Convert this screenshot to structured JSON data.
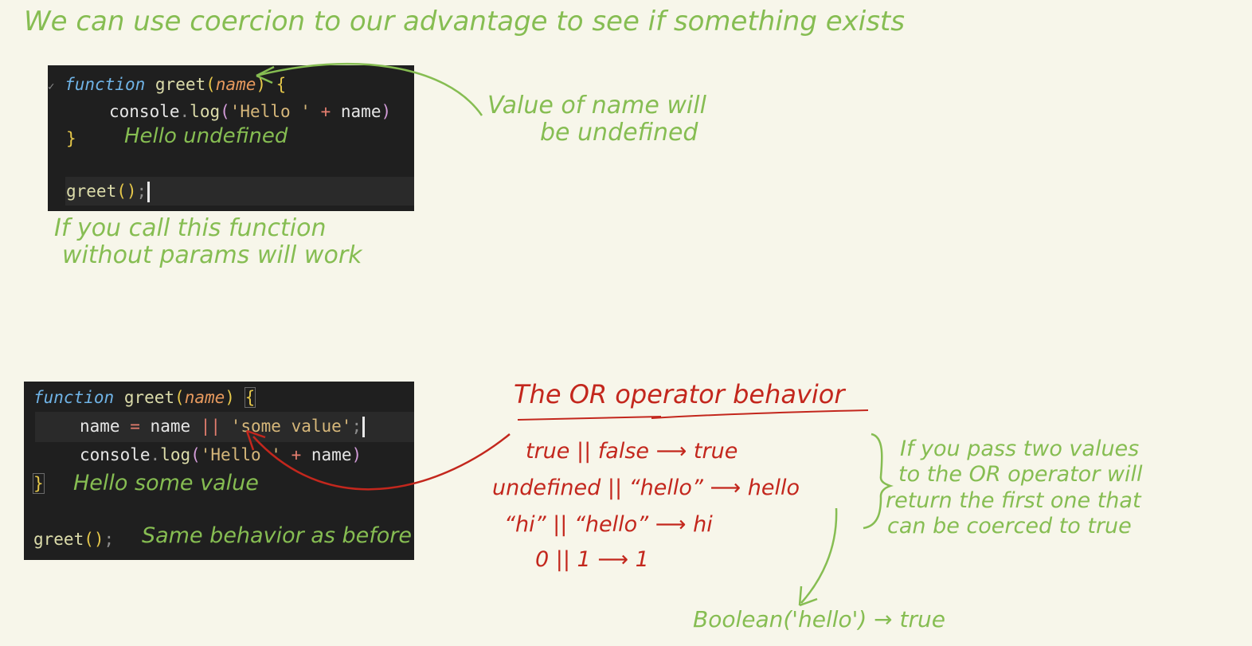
{
  "title": "We can use coercion to our advantage to see if something exists",
  "code_block_1": {
    "fold_marker": "✓",
    "line1_keyword": "function",
    "line1_name": "greet",
    "line1_open": "(",
    "line1_param": "name",
    "line1_close": ")",
    "line1_brace": "{",
    "line2_obj": "console",
    "line2_dot": ".",
    "line2_method": "log",
    "line2_open": "(",
    "line2_str": "'Hello '",
    "line2_plus": "+",
    "line2_var": "name",
    "line2_close": ")",
    "line3_brace": "}",
    "annotation": "Hello undefined",
    "line5_name": "greet",
    "line5_parens": "()",
    "line5_semi": ";"
  },
  "code_block_2": {
    "line1_keyword": "function",
    "line1_name": "greet",
    "line1_open": "(",
    "line1_param": "name",
    "line1_close": ")",
    "line1_brace": "{",
    "line2_var": "name",
    "line2_eq": "=",
    "line2_var2": "name",
    "line2_or": "||",
    "line2_str": "'some value'",
    "line2_semi": ";",
    "line3_obj": "console",
    "line3_dot": ".",
    "line3_method": "log",
    "line3_open": "(",
    "line3_str": "'Hello '",
    "line3_plus": "+",
    "line3_var": "name",
    "line3_close": ")",
    "line4_brace": "}",
    "annotation_line4": "Hello some value",
    "line6_name": "greet",
    "line6_parens": "()",
    "line6_semi": ";",
    "annotation_line6": "Same behavior as before"
  },
  "note_value_of_name": [
    "Value of name will",
    "be undefined"
  ],
  "note_call_without_params": [
    "If you call this function",
    "without params will work"
  ],
  "or_heading": "The OR operator behavior",
  "or_examples": [
    {
      "expr": "true || false",
      "result": "true"
    },
    {
      "expr": "undefined || “hello”",
      "result": "hello"
    },
    {
      "expr": "“hi” || “hello”",
      "result": "hi"
    },
    {
      "expr": "0 || 1",
      "result": "1"
    }
  ],
  "or_arrow": "⟶",
  "note_or_explanation": [
    "If you pass two values",
    "to the OR operator will",
    "return the first one that",
    "can be coerced to true"
  ],
  "boolean_note": "Boolean('hello') → true",
  "colors": {
    "green_ink": "#86bd52",
    "red_ink": "#c3271d",
    "editor_bg": "#1f1f1f",
    "paper": "#f7f6ea"
  }
}
